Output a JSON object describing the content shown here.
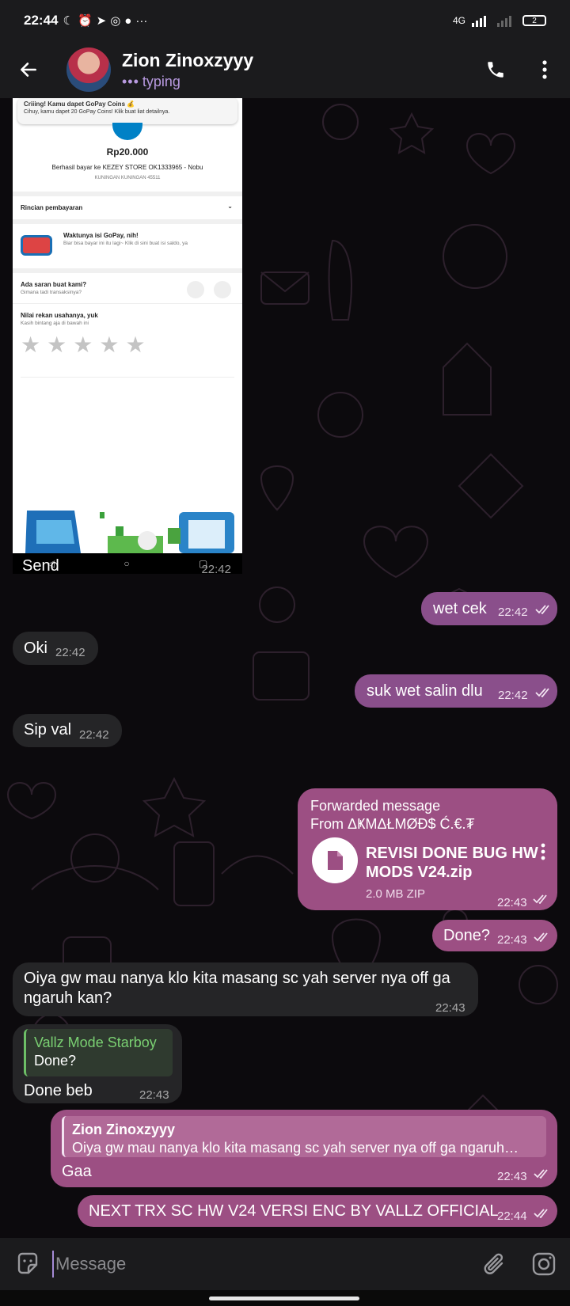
{
  "status_bar": {
    "time": "22:44",
    "network": "4G",
    "battery": "2"
  },
  "header": {
    "contact_name": "Zion Zinoxzyyy",
    "status": "typing",
    "back_icon": "arrow-left-icon",
    "call_icon": "phone-icon",
    "menu_icon": "more-vertical-icon"
  },
  "image_message": {
    "screenshot": {
      "notif_title": "Criiing! Kamu dapet GoPay Coins 💰",
      "notif_text": "Cihuy, kamu dapet 20 GoPay Coins! Klik buat liat detailnya.",
      "amount": "Rp20.000",
      "paid_to": "Berhasil bayar ke KEZEY STORE OK1333965 - Nobu",
      "location": "KUNINGAN KUNINGAN 45511",
      "details_label": "Rincian pembayaran",
      "topup_title": "Waktunya isi GoPay, nih!",
      "topup_text": "Biar bisa bayar ini itu lagi~ Klik di sini buat isi saldo, ya",
      "feedback_title": "Ada saran buat kami?",
      "feedback_sub": "Gimana tadi transaksinya?",
      "rating_title": "Nilai rekan usahanya, yuk",
      "rating_sub": "Kasih bintang aja di bawah ini",
      "rating_stars": 0
    },
    "caption": "Send",
    "time": "22:42"
  },
  "messages": [
    {
      "text": "wet cek",
      "time": "22:42"
    },
    {
      "text": "Oki",
      "time": "22:42"
    },
    {
      "text": "suk wet salin dlu",
      "time": "22:42"
    },
    {
      "text": "Sip val",
      "time": "22:42"
    },
    {
      "text": "Done?",
      "time": "22:43"
    },
    {
      "text": "Oiya gw mau nanya klo kita masang sc yah server nya off ga ngaruh kan?",
      "time": "22:43"
    },
    {
      "text": "Done beb",
      "time": "22:43"
    },
    {
      "text": "Gaa",
      "time": "22:43"
    },
    {
      "text": "NEXT TRX SC HW V24 VERSI ENC BY VALLZ OFFICIAL",
      "time": "22:44"
    }
  ],
  "forwarded": {
    "label": "Forwarded message",
    "from": "From ΔҜMΔŁMØĐ$ Ć.€.₮",
    "file_name_line1": "REVISI DONE BUG HW",
    "file_name_line2": "MODS V24.zip",
    "file_meta": "2.0 MB ZIP",
    "time": "22:43"
  },
  "replies": {
    "done_beb": {
      "author": "Vallz Mode Starboy",
      "text": "Done?"
    },
    "gaa": {
      "author": "Zion Zinoxzyyy",
      "text": "Oiya gw mau nanya klo kita masang sc yah server nya off ga ngaruh…"
    }
  },
  "input": {
    "placeholder": "Message"
  },
  "colors": {
    "outgoing": "#8a4f8b",
    "incoming": "#252527",
    "accent": "#b89ae0",
    "reply_green": "#6dbf67"
  }
}
